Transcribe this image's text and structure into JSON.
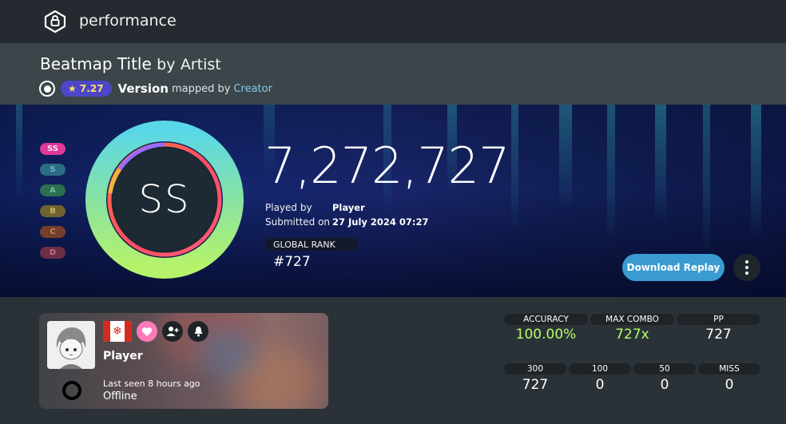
{
  "header": {
    "title": "performance",
    "logo_icon": "lock-hexagon-icon"
  },
  "beatmap": {
    "title": "Beatmap Title",
    "by_text": "by",
    "artist": "Artist",
    "mode_icon": "osu-circle-icon",
    "star_rating": "★ 7.27",
    "version": "Version",
    "mapped_by_text": "mapped by",
    "creator": "Creator"
  },
  "grades": [
    "SS",
    "S",
    "A",
    "B",
    "C",
    "D"
  ],
  "score": {
    "grade": "SS",
    "total": "7,272,727",
    "played_by_label": "Played by",
    "player": "Player",
    "submitted_label": "Submitted on",
    "submitted_date": "27 July 2024 07:27",
    "global_rank_label": "GLOBAL RANK",
    "global_rank": "#727",
    "download_label": "Download Replay",
    "more_icon": "more-vertical-icon"
  },
  "player_card": {
    "name": "Player",
    "country_flag": "canada-flag",
    "last_seen": "Last seen 8 hours ago",
    "status": "Offline",
    "icons": [
      "heart-icon",
      "add-friend-icon",
      "bell-icon"
    ]
  },
  "stats": {
    "accuracy_label": "ACCURACY",
    "accuracy": "100.00%",
    "max_combo_label": "MAX COMBO",
    "max_combo": "727x",
    "pp_label": "PP",
    "pp": "727",
    "n300_label": "300",
    "n300": "727",
    "n100_label": "100",
    "n100": "0",
    "n50_label": "50",
    "n50": "0",
    "miss_label": "MISS",
    "miss": "0"
  },
  "colors": {
    "accent_blue": "#3a9bd0",
    "star_badge": "#4d47c8",
    "accuracy_green": "#b4ff66",
    "ss_pill": "#e0379a"
  }
}
